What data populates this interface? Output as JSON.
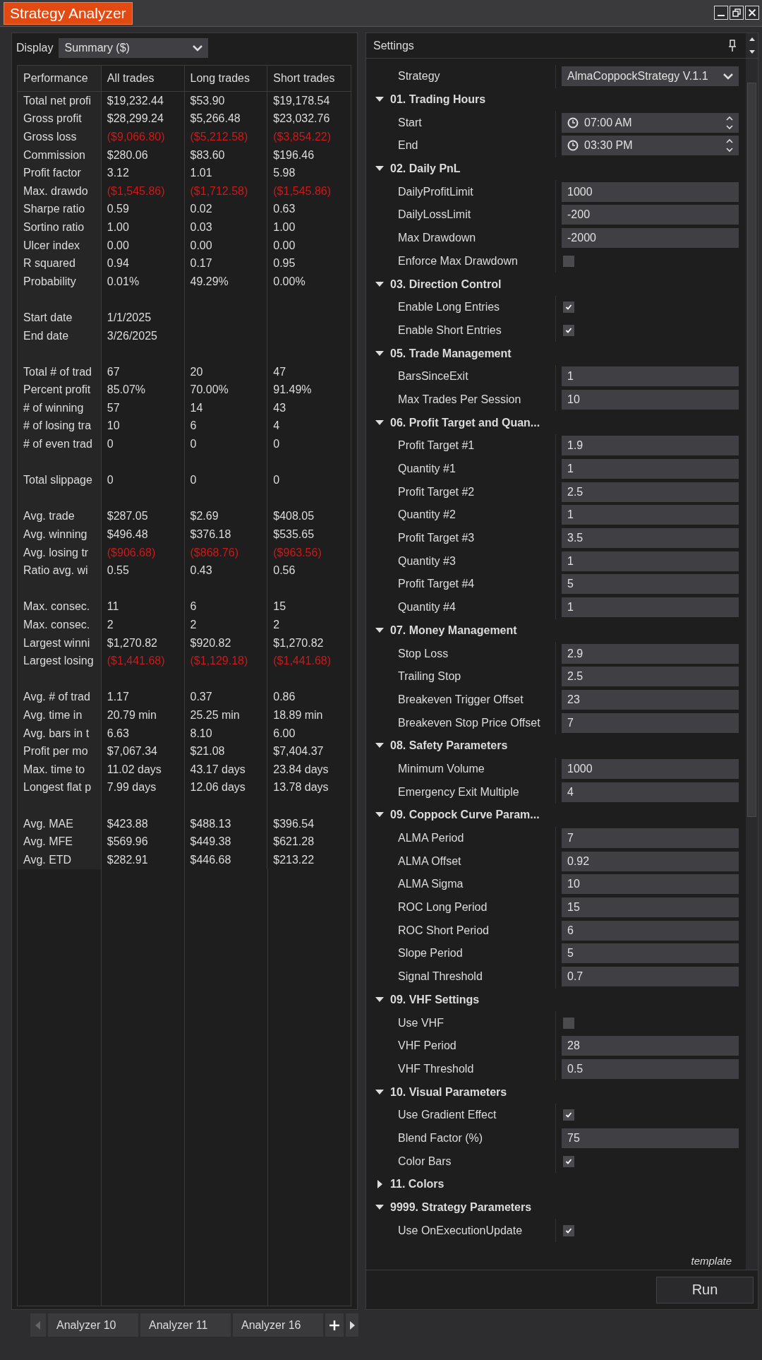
{
  "window": {
    "title": "Strategy Analyzer"
  },
  "analyzer": {
    "display_label": "Display",
    "display_value": "Summary ($)",
    "table": {
      "columns": [
        "Performance",
        "All trades",
        "Long trades",
        "Short trades"
      ],
      "rows": [
        {
          "kind": "data",
          "label": "Total net profi",
          "values": [
            "$19,232.44",
            "$53.90",
            "$19,178.54"
          ],
          "negative": false
        },
        {
          "kind": "data",
          "label": "Gross profit",
          "values": [
            "$28,299.24",
            "$5,266.48",
            "$23,032.76"
          ],
          "negative": false
        },
        {
          "kind": "data",
          "label": "Gross loss",
          "values": [
            "($9,066.80)",
            "($5,212.58)",
            "($3,854.22)"
          ],
          "negative": true
        },
        {
          "kind": "data",
          "label": "Commission",
          "values": [
            "$280.06",
            "$83.60",
            "$196.46"
          ],
          "negative": false
        },
        {
          "kind": "data",
          "label": "Profit factor",
          "values": [
            "3.12",
            "1.01",
            "5.98"
          ],
          "negative": false
        },
        {
          "kind": "data",
          "label": "Max. drawdo",
          "values": [
            "($1,545.86)",
            "($1,712.58)",
            "($1,545.86)"
          ],
          "negative": true
        },
        {
          "kind": "data",
          "label": "Sharpe ratio",
          "values": [
            "0.59",
            "0.02",
            "0.63"
          ],
          "negative": false
        },
        {
          "kind": "data",
          "label": "Sortino ratio",
          "values": [
            "1.00",
            "0.03",
            "1.00"
          ],
          "negative": false
        },
        {
          "kind": "data",
          "label": "Ulcer index",
          "values": [
            "0.00",
            "0.00",
            "0.00"
          ],
          "negative": false
        },
        {
          "kind": "data",
          "label": "R squared",
          "values": [
            "0.94",
            "0.17",
            "0.95"
          ],
          "negative": false
        },
        {
          "kind": "data",
          "label": "Probability",
          "values": [
            "0.01%",
            "49.29%",
            "0.00%"
          ],
          "negative": false
        },
        {
          "kind": "spacer"
        },
        {
          "kind": "data",
          "label": "Start date",
          "values": [
            "1/1/2025"
          ],
          "negative": false
        },
        {
          "kind": "data",
          "label": "End date",
          "values": [
            "3/26/2025"
          ],
          "negative": false
        },
        {
          "kind": "spacer"
        },
        {
          "kind": "data",
          "label": "Total # of trad",
          "values": [
            "67",
            "20",
            "47"
          ],
          "negative": false
        },
        {
          "kind": "data",
          "label": "Percent profit",
          "values": [
            "85.07%",
            "70.00%",
            "91.49%"
          ],
          "negative": false
        },
        {
          "kind": "data",
          "label": "# of winning",
          "values": [
            "57",
            "14",
            "43"
          ],
          "negative": false
        },
        {
          "kind": "data",
          "label": "# of losing tra",
          "values": [
            "10",
            "6",
            "4"
          ],
          "negative": false
        },
        {
          "kind": "data",
          "label": "# of even trad",
          "values": [
            "0",
            "0",
            "0"
          ],
          "negative": false
        },
        {
          "kind": "spacer"
        },
        {
          "kind": "data",
          "label": "Total slippage",
          "values": [
            "0",
            "0",
            "0"
          ],
          "negative": false
        },
        {
          "kind": "spacer"
        },
        {
          "kind": "data",
          "label": "Avg. trade",
          "values": [
            "$287.05",
            "$2.69",
            "$408.05"
          ],
          "negative": false
        },
        {
          "kind": "data",
          "label": "Avg. winning",
          "values": [
            "$496.48",
            "$376.18",
            "$535.65"
          ],
          "negative": false
        },
        {
          "kind": "data",
          "label": "Avg. losing tr",
          "values": [
            "($906.68)",
            "($868.76)",
            "($963.56)"
          ],
          "negative": true
        },
        {
          "kind": "data",
          "label": "Ratio avg. wi",
          "values": [
            "0.55",
            "0.43",
            "0.56"
          ],
          "negative": false
        },
        {
          "kind": "spacer"
        },
        {
          "kind": "data",
          "label": "Max. consec.",
          "values": [
            "11",
            "6",
            "15"
          ],
          "negative": false
        },
        {
          "kind": "data",
          "label": "Max. consec.",
          "values": [
            "2",
            "2",
            "2"
          ],
          "negative": false
        },
        {
          "kind": "data",
          "label": "Largest winni",
          "values": [
            "$1,270.82",
            "$920.82",
            "$1,270.82"
          ],
          "negative": false
        },
        {
          "kind": "data",
          "label": "Largest losing",
          "values": [
            "($1,441.68)",
            "($1,129.18)",
            "($1,441.68)"
          ],
          "negative": true
        },
        {
          "kind": "spacer"
        },
        {
          "kind": "data",
          "label": "Avg. # of trad",
          "values": [
            "1.17",
            "0.37",
            "0.86"
          ],
          "negative": false
        },
        {
          "kind": "data",
          "label": "Avg. time in",
          "values": [
            "20.79 min",
            "25.25 min",
            "18.89 min"
          ],
          "negative": false
        },
        {
          "kind": "data",
          "label": "Avg. bars in t",
          "values": [
            "6.63",
            "8.10",
            "6.00"
          ],
          "negative": false
        },
        {
          "kind": "data",
          "label": "Profit per mo",
          "values": [
            "$7,067.34",
            "$21.08",
            "$7,404.37"
          ],
          "negative": false
        },
        {
          "kind": "data",
          "label": "Max. time to",
          "values": [
            "11.02 days",
            "43.17 days",
            "23.84 days"
          ],
          "negative": false
        },
        {
          "kind": "data",
          "label": "Longest flat p",
          "values": [
            "7.99 days",
            "12.06 days",
            "13.78 days"
          ],
          "negative": false
        },
        {
          "kind": "spacer"
        },
        {
          "kind": "data",
          "label": "Avg. MAE",
          "values": [
            "$423.88",
            "$488.13",
            "$396.54"
          ],
          "negative": false
        },
        {
          "kind": "data",
          "label": "Avg. MFE",
          "values": [
            "$569.96",
            "$449.38",
            "$621.28"
          ],
          "negative": false
        },
        {
          "kind": "data",
          "label": "Avg. ETD",
          "values": [
            "$282.91",
            "$446.68",
            "$213.22"
          ],
          "negative": false
        }
      ]
    }
  },
  "tabs": [
    {
      "label": "Analyzer 10"
    },
    {
      "label": "Analyzer 11"
    },
    {
      "label": "Analyzer 16"
    }
  ],
  "settings": {
    "title": "Settings",
    "strategy": {
      "label": "Strategy",
      "value": "AlmaCoppockStrategy V.1.1"
    },
    "categories": [
      {
        "label": "01. Trading Hours",
        "expanded": true,
        "children": [
          {
            "kind": "time",
            "label": "Start",
            "value": "07:00 AM"
          },
          {
            "kind": "time",
            "label": "End",
            "value": "03:30 PM"
          }
        ]
      },
      {
        "label": "02. Daily PnL",
        "expanded": true,
        "children": [
          {
            "kind": "text",
            "label": "DailyProfitLimit",
            "value": "1000"
          },
          {
            "kind": "text",
            "label": "DailyLossLimit",
            "value": "-200"
          },
          {
            "kind": "text",
            "label": "Max Drawdown",
            "value": "-2000"
          },
          {
            "kind": "check",
            "label": "Enforce Max Drawdown",
            "checked": false
          }
        ]
      },
      {
        "label": "03. Direction Control",
        "expanded": true,
        "children": [
          {
            "kind": "check",
            "label": "Enable Long Entries",
            "checked": true
          },
          {
            "kind": "check",
            "label": "Enable Short Entries",
            "checked": true
          }
        ]
      },
      {
        "label": "05. Trade Management",
        "expanded": true,
        "children": [
          {
            "kind": "text",
            "label": "BarsSinceExit",
            "value": "1"
          },
          {
            "kind": "text",
            "label": "Max Trades Per Session",
            "value": "10"
          }
        ]
      },
      {
        "label": "06. Profit Target and Quan...",
        "expanded": true,
        "children": [
          {
            "kind": "text",
            "label": "Profit Target #1",
            "value": "1.9"
          },
          {
            "kind": "text",
            "label": "Quantity #1",
            "value": "1"
          },
          {
            "kind": "text",
            "label": "Profit Target #2",
            "value": "2.5"
          },
          {
            "kind": "text",
            "label": "Quantity #2",
            "value": "1"
          },
          {
            "kind": "text",
            "label": "Profit Target #3",
            "value": "3.5"
          },
          {
            "kind": "text",
            "label": "Quantity #3",
            "value": "1"
          },
          {
            "kind": "text",
            "label": "Profit Target #4",
            "value": "5"
          },
          {
            "kind": "text",
            "label": "Quantity #4",
            "value": "1"
          }
        ]
      },
      {
        "label": "07. Money Management",
        "expanded": true,
        "children": [
          {
            "kind": "text",
            "label": "Stop Loss",
            "value": "2.9"
          },
          {
            "kind": "text",
            "label": "Trailing Stop",
            "value": "2.5"
          },
          {
            "kind": "text",
            "label": "Breakeven Trigger Offset",
            "value": "23"
          },
          {
            "kind": "text",
            "label": "Breakeven Stop Price Offset",
            "value": "7"
          }
        ]
      },
      {
        "label": "08. Safety Parameters",
        "expanded": true,
        "children": [
          {
            "kind": "text",
            "label": "Minimum Volume",
            "value": "1000"
          },
          {
            "kind": "text",
            "label": "Emergency Exit Multiple",
            "value": "4"
          }
        ]
      },
      {
        "label": "09. Coppock Curve Param...",
        "expanded": true,
        "children": [
          {
            "kind": "text",
            "label": "ALMA Period",
            "value": "7"
          },
          {
            "kind": "text",
            "label": "ALMA Offset",
            "value": "0.92"
          },
          {
            "kind": "text",
            "label": "ALMA Sigma",
            "value": "10"
          },
          {
            "kind": "text",
            "label": "ROC Long Period",
            "value": "15"
          },
          {
            "kind": "text",
            "label": "ROC Short Period",
            "value": "6"
          },
          {
            "kind": "text",
            "label": "Slope Period",
            "value": "5"
          },
          {
            "kind": "text",
            "label": "Signal Threshold",
            "value": "0.7"
          }
        ]
      },
      {
        "label": "09. VHF Settings",
        "expanded": true,
        "children": [
          {
            "kind": "check",
            "label": "Use VHF",
            "checked": false
          },
          {
            "kind": "text",
            "label": "VHF Period",
            "value": "28"
          },
          {
            "kind": "text",
            "label": "VHF Threshold",
            "value": "0.5"
          }
        ]
      },
      {
        "label": "10. Visual Parameters",
        "expanded": true,
        "children": [
          {
            "kind": "check",
            "label": "Use Gradient Effect",
            "checked": true
          },
          {
            "kind": "text",
            "label": "Blend Factor (%)",
            "value": "75"
          },
          {
            "kind": "check",
            "label": "Color Bars",
            "checked": true
          }
        ]
      },
      {
        "label": "11. Colors",
        "expanded": false
      },
      {
        "label": "9999. Strategy Parameters",
        "expanded": true,
        "children": [
          {
            "kind": "check",
            "label": "Use OnExecutionUpdate",
            "checked": true
          }
        ]
      }
    ],
    "template_label": "template",
    "run_button": "Run"
  }
}
